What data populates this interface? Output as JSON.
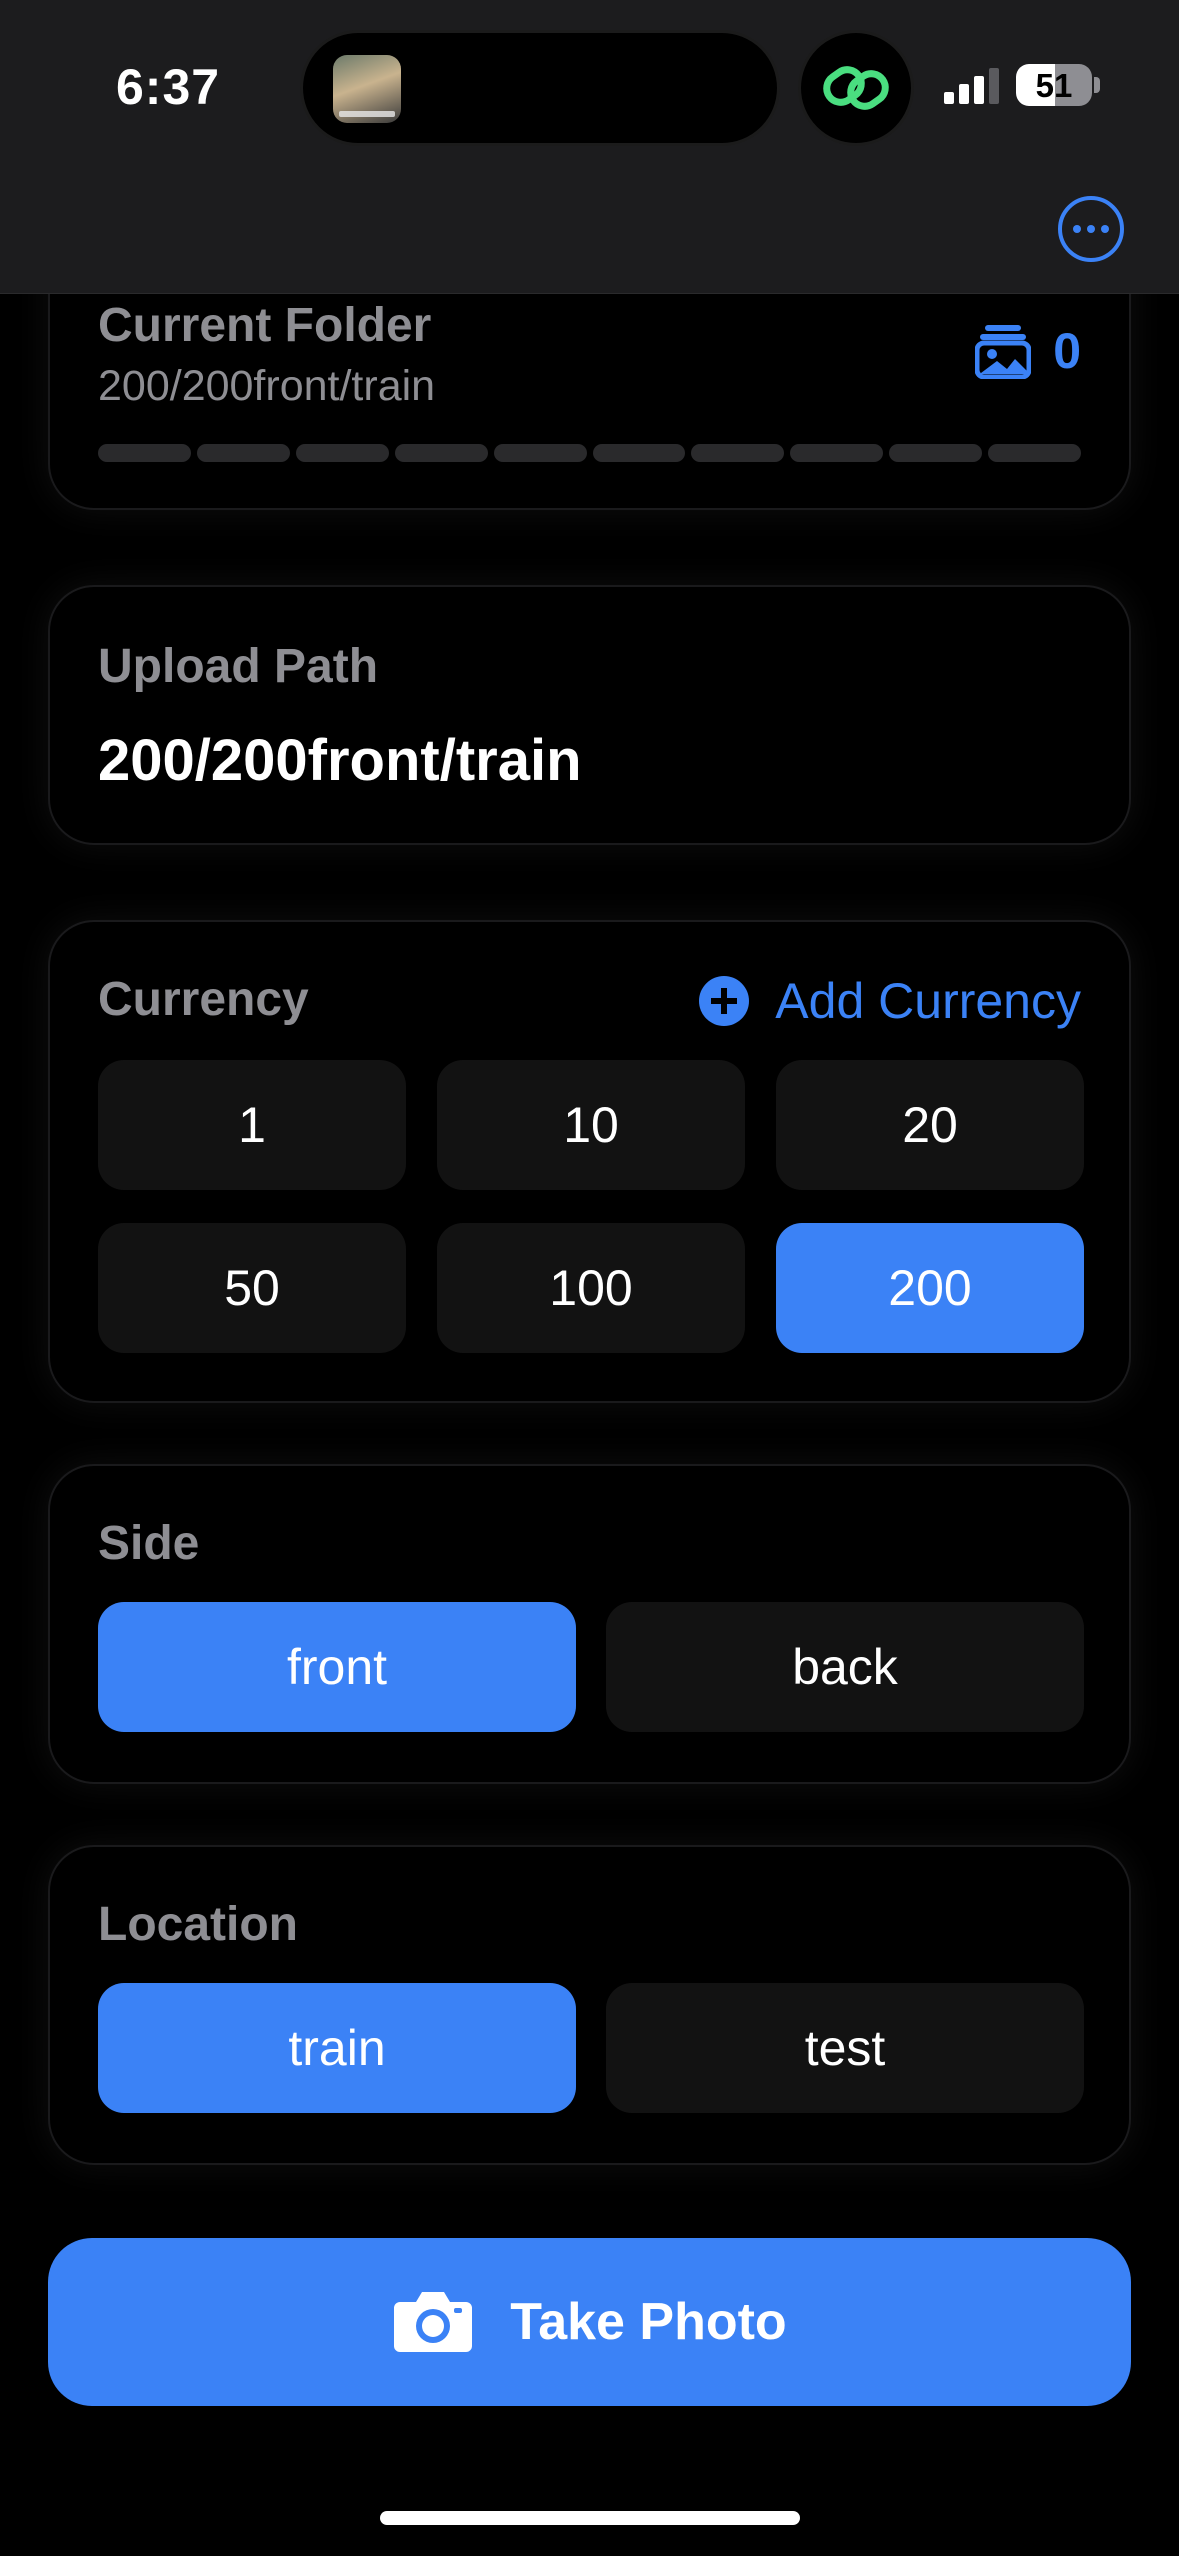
{
  "status_bar": {
    "time": "6:37",
    "battery_percent": "51",
    "battery_level": 0.51,
    "signal_bars": 3
  },
  "current_folder": {
    "label": "Current Folder",
    "path": "200/200front/train",
    "photo_count": "0",
    "progress_segments": 10
  },
  "upload_path": {
    "label": "Upload Path",
    "value": "200/200front/train"
  },
  "currency": {
    "label": "Currency",
    "add_label": "Add Currency",
    "options": [
      "1",
      "10",
      "20",
      "50",
      "100",
      "200"
    ],
    "selected": "200"
  },
  "side": {
    "label": "Side",
    "options": [
      "front",
      "back"
    ],
    "selected": "front"
  },
  "location": {
    "label": "Location",
    "options": [
      "train",
      "test"
    ],
    "selected": "train"
  },
  "take_photo": {
    "label": "Take Photo"
  },
  "colors": {
    "accent": "#3b82f6",
    "chip": "#121212",
    "secondary_text": "#8e8e93",
    "chain_icon": "#4ade80"
  }
}
